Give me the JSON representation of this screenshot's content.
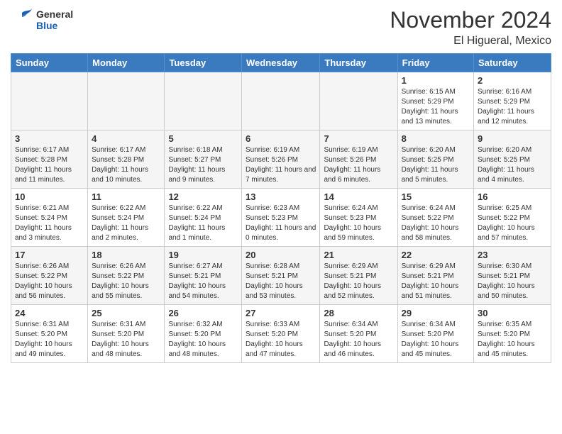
{
  "logo": {
    "general": "General",
    "blue": "Blue"
  },
  "header": {
    "month": "November 2024",
    "location": "El Higueral, Mexico"
  },
  "weekdays": [
    "Sunday",
    "Monday",
    "Tuesday",
    "Wednesday",
    "Thursday",
    "Friday",
    "Saturday"
  ],
  "weeks": [
    [
      {
        "day": "",
        "info": "",
        "empty": true
      },
      {
        "day": "",
        "info": "",
        "empty": true
      },
      {
        "day": "",
        "info": "",
        "empty": true
      },
      {
        "day": "",
        "info": "",
        "empty": true
      },
      {
        "day": "",
        "info": "",
        "empty": true
      },
      {
        "day": "1",
        "info": "Sunrise: 6:15 AM\nSunset: 5:29 PM\nDaylight: 11 hours and 13 minutes."
      },
      {
        "day": "2",
        "info": "Sunrise: 6:16 AM\nSunset: 5:29 PM\nDaylight: 11 hours and 12 minutes."
      }
    ],
    [
      {
        "day": "3",
        "info": "Sunrise: 6:17 AM\nSunset: 5:28 PM\nDaylight: 11 hours and 11 minutes."
      },
      {
        "day": "4",
        "info": "Sunrise: 6:17 AM\nSunset: 5:28 PM\nDaylight: 11 hours and 10 minutes."
      },
      {
        "day": "5",
        "info": "Sunrise: 6:18 AM\nSunset: 5:27 PM\nDaylight: 11 hours and 9 minutes."
      },
      {
        "day": "6",
        "info": "Sunrise: 6:19 AM\nSunset: 5:26 PM\nDaylight: 11 hours and 7 minutes."
      },
      {
        "day": "7",
        "info": "Sunrise: 6:19 AM\nSunset: 5:26 PM\nDaylight: 11 hours and 6 minutes."
      },
      {
        "day": "8",
        "info": "Sunrise: 6:20 AM\nSunset: 5:25 PM\nDaylight: 11 hours and 5 minutes."
      },
      {
        "day": "9",
        "info": "Sunrise: 6:20 AM\nSunset: 5:25 PM\nDaylight: 11 hours and 4 minutes."
      }
    ],
    [
      {
        "day": "10",
        "info": "Sunrise: 6:21 AM\nSunset: 5:24 PM\nDaylight: 11 hours and 3 minutes."
      },
      {
        "day": "11",
        "info": "Sunrise: 6:22 AM\nSunset: 5:24 PM\nDaylight: 11 hours and 2 minutes."
      },
      {
        "day": "12",
        "info": "Sunrise: 6:22 AM\nSunset: 5:24 PM\nDaylight: 11 hours and 1 minute."
      },
      {
        "day": "13",
        "info": "Sunrise: 6:23 AM\nSunset: 5:23 PM\nDaylight: 11 hours and 0 minutes."
      },
      {
        "day": "14",
        "info": "Sunrise: 6:24 AM\nSunset: 5:23 PM\nDaylight: 10 hours and 59 minutes."
      },
      {
        "day": "15",
        "info": "Sunrise: 6:24 AM\nSunset: 5:22 PM\nDaylight: 10 hours and 58 minutes."
      },
      {
        "day": "16",
        "info": "Sunrise: 6:25 AM\nSunset: 5:22 PM\nDaylight: 10 hours and 57 minutes."
      }
    ],
    [
      {
        "day": "17",
        "info": "Sunrise: 6:26 AM\nSunset: 5:22 PM\nDaylight: 10 hours and 56 minutes."
      },
      {
        "day": "18",
        "info": "Sunrise: 6:26 AM\nSunset: 5:22 PM\nDaylight: 10 hours and 55 minutes."
      },
      {
        "day": "19",
        "info": "Sunrise: 6:27 AM\nSunset: 5:21 PM\nDaylight: 10 hours and 54 minutes."
      },
      {
        "day": "20",
        "info": "Sunrise: 6:28 AM\nSunset: 5:21 PM\nDaylight: 10 hours and 53 minutes."
      },
      {
        "day": "21",
        "info": "Sunrise: 6:29 AM\nSunset: 5:21 PM\nDaylight: 10 hours and 52 minutes."
      },
      {
        "day": "22",
        "info": "Sunrise: 6:29 AM\nSunset: 5:21 PM\nDaylight: 10 hours and 51 minutes."
      },
      {
        "day": "23",
        "info": "Sunrise: 6:30 AM\nSunset: 5:21 PM\nDaylight: 10 hours and 50 minutes."
      }
    ],
    [
      {
        "day": "24",
        "info": "Sunrise: 6:31 AM\nSunset: 5:20 PM\nDaylight: 10 hours and 49 minutes."
      },
      {
        "day": "25",
        "info": "Sunrise: 6:31 AM\nSunset: 5:20 PM\nDaylight: 10 hours and 48 minutes."
      },
      {
        "day": "26",
        "info": "Sunrise: 6:32 AM\nSunset: 5:20 PM\nDaylight: 10 hours and 48 minutes."
      },
      {
        "day": "27",
        "info": "Sunrise: 6:33 AM\nSunset: 5:20 PM\nDaylight: 10 hours and 47 minutes."
      },
      {
        "day": "28",
        "info": "Sunrise: 6:34 AM\nSunset: 5:20 PM\nDaylight: 10 hours and 46 minutes."
      },
      {
        "day": "29",
        "info": "Sunrise: 6:34 AM\nSunset: 5:20 PM\nDaylight: 10 hours and 45 minutes."
      },
      {
        "day": "30",
        "info": "Sunrise: 6:35 AM\nSunset: 5:20 PM\nDaylight: 10 hours and 45 minutes."
      }
    ]
  ]
}
